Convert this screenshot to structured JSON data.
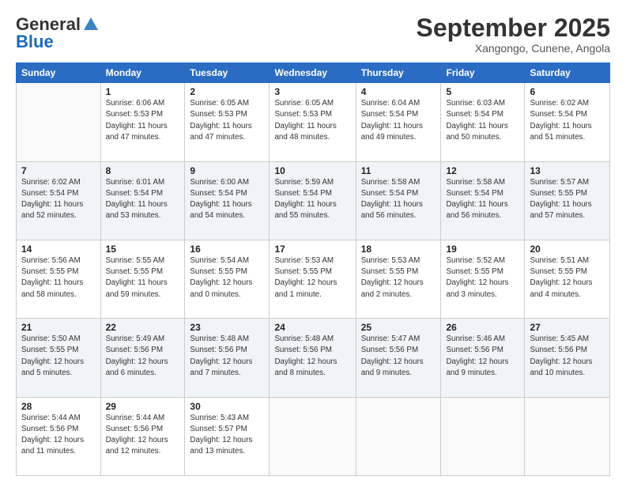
{
  "logo": {
    "part1": "General",
    "part2": "Blue"
  },
  "title": "September 2025",
  "location": "Xangongo, Cunene, Angola",
  "days_header": [
    "Sunday",
    "Monday",
    "Tuesday",
    "Wednesday",
    "Thursday",
    "Friday",
    "Saturday"
  ],
  "weeks": [
    [
      {
        "num": "",
        "info": ""
      },
      {
        "num": "1",
        "info": "Sunrise: 6:06 AM\nSunset: 5:53 PM\nDaylight: 11 hours\nand 47 minutes."
      },
      {
        "num": "2",
        "info": "Sunrise: 6:05 AM\nSunset: 5:53 PM\nDaylight: 11 hours\nand 47 minutes."
      },
      {
        "num": "3",
        "info": "Sunrise: 6:05 AM\nSunset: 5:53 PM\nDaylight: 11 hours\nand 48 minutes."
      },
      {
        "num": "4",
        "info": "Sunrise: 6:04 AM\nSunset: 5:54 PM\nDaylight: 11 hours\nand 49 minutes."
      },
      {
        "num": "5",
        "info": "Sunrise: 6:03 AM\nSunset: 5:54 PM\nDaylight: 11 hours\nand 50 minutes."
      },
      {
        "num": "6",
        "info": "Sunrise: 6:02 AM\nSunset: 5:54 PM\nDaylight: 11 hours\nand 51 minutes."
      }
    ],
    [
      {
        "num": "7",
        "info": "Sunrise: 6:02 AM\nSunset: 5:54 PM\nDaylight: 11 hours\nand 52 minutes."
      },
      {
        "num": "8",
        "info": "Sunrise: 6:01 AM\nSunset: 5:54 PM\nDaylight: 11 hours\nand 53 minutes."
      },
      {
        "num": "9",
        "info": "Sunrise: 6:00 AM\nSunset: 5:54 PM\nDaylight: 11 hours\nand 54 minutes."
      },
      {
        "num": "10",
        "info": "Sunrise: 5:59 AM\nSunset: 5:54 PM\nDaylight: 11 hours\nand 55 minutes."
      },
      {
        "num": "11",
        "info": "Sunrise: 5:58 AM\nSunset: 5:54 PM\nDaylight: 11 hours\nand 56 minutes."
      },
      {
        "num": "12",
        "info": "Sunrise: 5:58 AM\nSunset: 5:54 PM\nDaylight: 11 hours\nand 56 minutes."
      },
      {
        "num": "13",
        "info": "Sunrise: 5:57 AM\nSunset: 5:55 PM\nDaylight: 11 hours\nand 57 minutes."
      }
    ],
    [
      {
        "num": "14",
        "info": "Sunrise: 5:56 AM\nSunset: 5:55 PM\nDaylight: 11 hours\nand 58 minutes."
      },
      {
        "num": "15",
        "info": "Sunrise: 5:55 AM\nSunset: 5:55 PM\nDaylight: 11 hours\nand 59 minutes."
      },
      {
        "num": "16",
        "info": "Sunrise: 5:54 AM\nSunset: 5:55 PM\nDaylight: 12 hours\nand 0 minutes."
      },
      {
        "num": "17",
        "info": "Sunrise: 5:53 AM\nSunset: 5:55 PM\nDaylight: 12 hours\nand 1 minute."
      },
      {
        "num": "18",
        "info": "Sunrise: 5:53 AM\nSunset: 5:55 PM\nDaylight: 12 hours\nand 2 minutes."
      },
      {
        "num": "19",
        "info": "Sunrise: 5:52 AM\nSunset: 5:55 PM\nDaylight: 12 hours\nand 3 minutes."
      },
      {
        "num": "20",
        "info": "Sunrise: 5:51 AM\nSunset: 5:55 PM\nDaylight: 12 hours\nand 4 minutes."
      }
    ],
    [
      {
        "num": "21",
        "info": "Sunrise: 5:50 AM\nSunset: 5:55 PM\nDaylight: 12 hours\nand 5 minutes."
      },
      {
        "num": "22",
        "info": "Sunrise: 5:49 AM\nSunset: 5:56 PM\nDaylight: 12 hours\nand 6 minutes."
      },
      {
        "num": "23",
        "info": "Sunrise: 5:48 AM\nSunset: 5:56 PM\nDaylight: 12 hours\nand 7 minutes."
      },
      {
        "num": "24",
        "info": "Sunrise: 5:48 AM\nSunset: 5:56 PM\nDaylight: 12 hours\nand 8 minutes."
      },
      {
        "num": "25",
        "info": "Sunrise: 5:47 AM\nSunset: 5:56 PM\nDaylight: 12 hours\nand 9 minutes."
      },
      {
        "num": "26",
        "info": "Sunrise: 5:46 AM\nSunset: 5:56 PM\nDaylight: 12 hours\nand 9 minutes."
      },
      {
        "num": "27",
        "info": "Sunrise: 5:45 AM\nSunset: 5:56 PM\nDaylight: 12 hours\nand 10 minutes."
      }
    ],
    [
      {
        "num": "28",
        "info": "Sunrise: 5:44 AM\nSunset: 5:56 PM\nDaylight: 12 hours\nand 11 minutes."
      },
      {
        "num": "29",
        "info": "Sunrise: 5:44 AM\nSunset: 5:56 PM\nDaylight: 12 hours\nand 12 minutes."
      },
      {
        "num": "30",
        "info": "Sunrise: 5:43 AM\nSunset: 5:57 PM\nDaylight: 12 hours\nand 13 minutes."
      },
      {
        "num": "",
        "info": ""
      },
      {
        "num": "",
        "info": ""
      },
      {
        "num": "",
        "info": ""
      },
      {
        "num": "",
        "info": ""
      }
    ]
  ]
}
